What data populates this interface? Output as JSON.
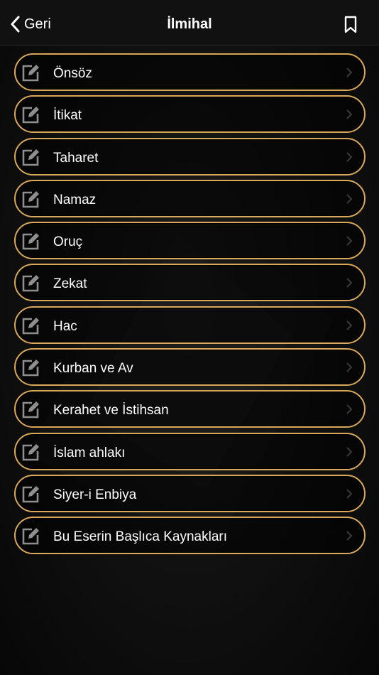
{
  "nav": {
    "back_label": "Geri",
    "title": "İlmihal"
  },
  "list": {
    "items": [
      {
        "label": "Önsöz"
      },
      {
        "label": "İtikat"
      },
      {
        "label": "Taharet"
      },
      {
        "label": "Namaz"
      },
      {
        "label": "Oruç"
      },
      {
        "label": "Zekat"
      },
      {
        "label": "Hac"
      },
      {
        "label": "Kurban ve Av"
      },
      {
        "label": "Kerahet ve İstihsan"
      },
      {
        "label": "İslam ahlakı"
      },
      {
        "label": "Siyer-i Enbiya"
      },
      {
        "label": "Bu Eserin Başlıca Kaynakları"
      }
    ]
  },
  "icons": {
    "back": "chevron-left-icon",
    "bookmark": "bookmark-icon",
    "item": "edit-icon",
    "disclosure": "chevron-right-icon"
  },
  "colors": {
    "accent_border": "#d9a85b",
    "background": "#0b0b0b",
    "text": "#ffffff"
  }
}
